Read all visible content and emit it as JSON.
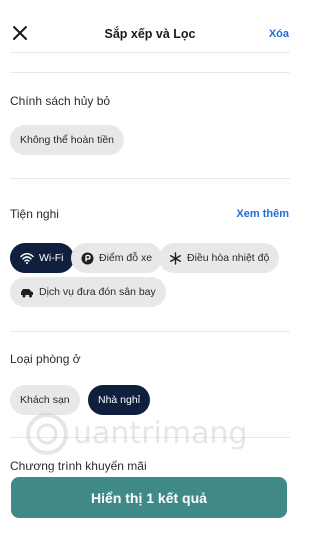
{
  "header": {
    "title": "Sắp xếp và Lọc",
    "clear_label": "Xóa"
  },
  "cancellation": {
    "title": "Chính sách hủy bỏ",
    "chips": [
      {
        "label": "Không thể hoàn tiền",
        "selected": false
      }
    ]
  },
  "amenities": {
    "title": "Tiện nghi",
    "see_more_label": "Xem thêm",
    "chips": [
      {
        "label": "Wi-Fi",
        "icon": "wifi-icon",
        "selected": true
      },
      {
        "label": "Điểm đỗ xe",
        "icon": "parking-icon",
        "selected": false
      },
      {
        "label": "Điều hòa nhiệt độ",
        "icon": "snowflake-icon",
        "selected": false
      },
      {
        "label": "Dịch vụ đưa đón sân bay",
        "icon": "shuttle-car-icon",
        "selected": false
      }
    ]
  },
  "room_type": {
    "title": "Loại phòng ở",
    "chips": [
      {
        "label": "Khách sạn",
        "selected": false
      },
      {
        "label": "Nhà nghỉ",
        "selected": true
      }
    ]
  },
  "promotions": {
    "title": "Chương trình khuyến mãi"
  },
  "footer": {
    "show_results_label": "Hiển thị 1 kết quả"
  },
  "watermark": {
    "text": "uantrimang"
  },
  "colors": {
    "accent_link": "#1f6fd1",
    "selected_chip": "#0f1f3d",
    "primary_button": "#3f8a88",
    "chip_bg": "#e8e8e8"
  }
}
